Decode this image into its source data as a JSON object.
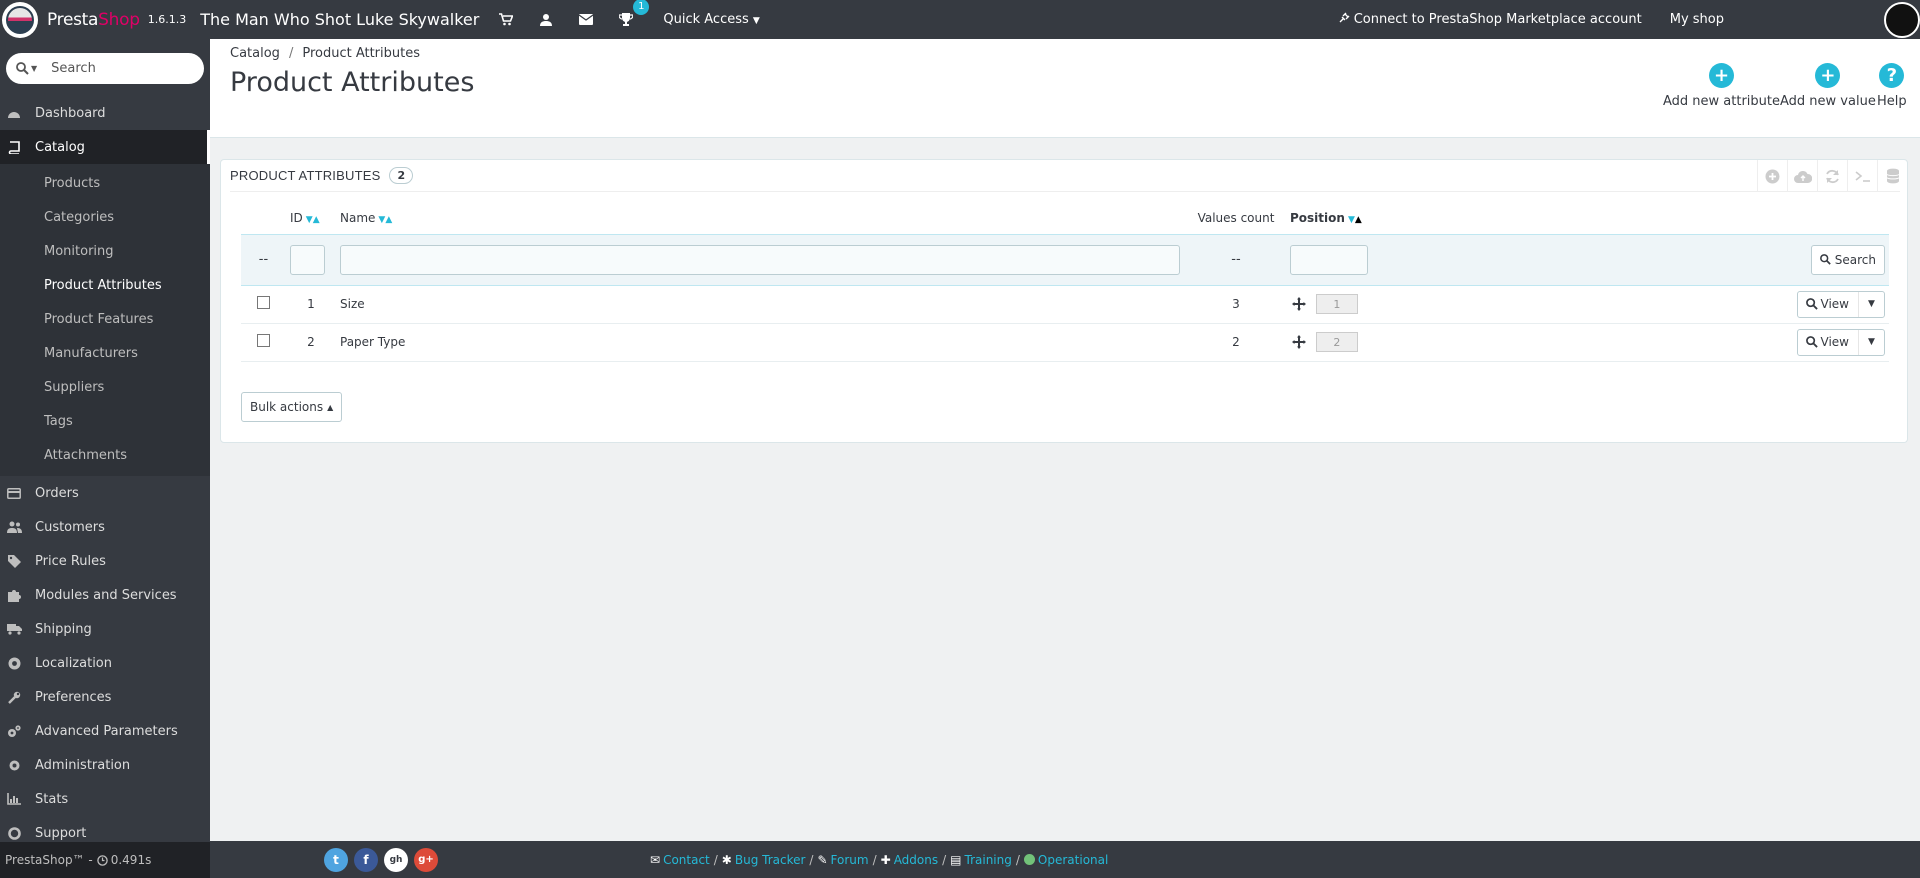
{
  "header": {
    "brand_presta": "Presta",
    "brand_shop": "Shop",
    "version": "1.6.1.3",
    "shop_name": "The Man Who Shot Luke Skywalker",
    "notification_badge": "1",
    "quick_access": "Quick Access",
    "connect_label": "Connect to PrestaShop Marketplace account",
    "my_shop": "My shop"
  },
  "sidebar": {
    "search_placeholder": "Search",
    "menu": [
      {
        "label": "Dashboard",
        "icon": "dashboard-icon"
      },
      {
        "label": "Catalog",
        "icon": "book-icon"
      },
      {
        "label": "Orders",
        "icon": "credit-card-icon"
      },
      {
        "label": "Customers",
        "icon": "users-icon"
      },
      {
        "label": "Price Rules",
        "icon": "tag-icon"
      },
      {
        "label": "Modules and Services",
        "icon": "puzzle-icon"
      },
      {
        "label": "Shipping",
        "icon": "truck-icon"
      },
      {
        "label": "Localization",
        "icon": "globe-icon"
      },
      {
        "label": "Preferences",
        "icon": "wrench-icon"
      },
      {
        "label": "Advanced Parameters",
        "icon": "cogs-icon"
      },
      {
        "label": "Administration",
        "icon": "cog-icon"
      },
      {
        "label": "Stats",
        "icon": "bar-chart-icon"
      },
      {
        "label": "Support",
        "icon": "lifebuoy-icon"
      }
    ],
    "catalog_sub": [
      "Products",
      "Categories",
      "Monitoring",
      "Product Attributes",
      "Product Features",
      "Manufacturers",
      "Suppliers",
      "Tags",
      "Attachments"
    ],
    "footer_text": "PrestaShop™ -",
    "footer_time": "0.491s"
  },
  "toolbar": {
    "breadcrumb_1": "Catalog",
    "breadcrumb_sep": "/",
    "breadcrumb_2": "Product Attributes",
    "title": "Product Attributes",
    "add_attribute": "Add new attribute",
    "add_value": "Add new value",
    "help": "Help"
  },
  "panel": {
    "title": "Product attributes",
    "count": "2",
    "columns": {
      "id": "ID",
      "name": "Name",
      "values_count": "Values count",
      "position": "Position"
    },
    "filter": {
      "placeholder_dash": "--",
      "values_dash": "--",
      "search_button": "Search"
    },
    "rows": [
      {
        "id": "1",
        "name": "Size",
        "values_count": "3",
        "position": "1",
        "action": "View"
      },
      {
        "id": "2",
        "name": "Paper Type",
        "values_count": "2",
        "position": "2",
        "action": "View"
      }
    ],
    "bulk_actions": "Bulk actions"
  },
  "footer": {
    "contact": "Contact",
    "bug_tracker": "Bug Tracker",
    "forum": "Forum",
    "addons": "Addons",
    "training": "Training",
    "operational": "Operational",
    "sep": "/",
    "social_twitter": "t",
    "social_facebook": "f",
    "social_github": "gh",
    "social_google": "g+"
  },
  "colors": {
    "accent": "#25b9d7",
    "header_bg": "#363a41",
    "brand_pink": "#df0067",
    "operational_green": "#72c279"
  }
}
